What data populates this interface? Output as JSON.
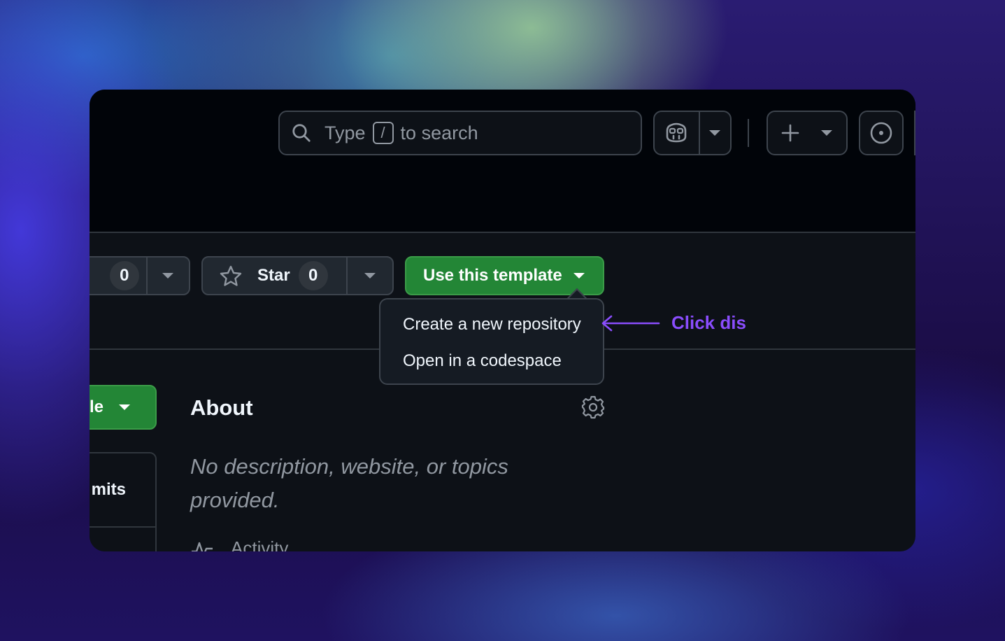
{
  "header": {
    "search": {
      "label_before": "Type",
      "shortcut_key": "/",
      "label_after": "to search"
    }
  },
  "repo_actions": {
    "watch_count": "0",
    "star": {
      "label": "Star",
      "count": "0"
    },
    "template_button": {
      "label": "Use this template"
    },
    "template_menu": [
      {
        "label": "Create a new repository"
      },
      {
        "label": "Open in a codespace"
      }
    ]
  },
  "code_button": {
    "label_partial": "le"
  },
  "commits": {
    "label_partial": "mits"
  },
  "about": {
    "title": "About",
    "description": "No description, website, or topics provided.",
    "activity": "Activity"
  },
  "annotation": {
    "label": "Click dis",
    "color": "#8a4dfd"
  },
  "colors": {
    "accent_green": "#238636",
    "header_bg": "#010409",
    "page_bg": "#0d1117"
  },
  "icons": [
    "search-icon",
    "copilot-icon",
    "plus-icon",
    "issue-circle-icon",
    "star-icon",
    "gear-icon",
    "pulse-icon",
    "arrow-left-icon"
  ]
}
